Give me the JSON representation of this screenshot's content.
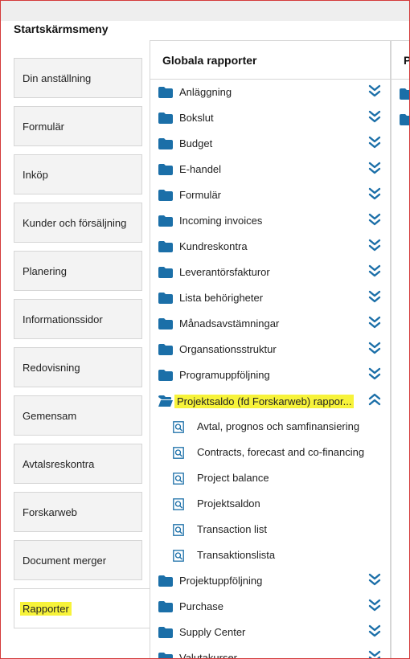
{
  "page_title": "Startskärmsmeny",
  "menu": [
    {
      "label": "Din anställning"
    },
    {
      "label": "Formulär"
    },
    {
      "label": "Inköp"
    },
    {
      "label": "Kunder och försäljning"
    },
    {
      "label": "Planering"
    },
    {
      "label": "Informationssidor"
    },
    {
      "label": "Redovisning"
    },
    {
      "label": "Gemensam"
    },
    {
      "label": "Avtalsreskontra"
    },
    {
      "label": "Forskarweb"
    },
    {
      "label": "Document merger"
    },
    {
      "label": "Rapporter",
      "active": true
    }
  ],
  "panel": {
    "title": "Globala rapporter",
    "folders_before": [
      "Anläggning",
      "Bokslut",
      "Budget",
      "E-handel",
      "Formulär",
      "Incoming invoices",
      "Kundreskontra",
      "Leverantörsfakturor",
      "Lista behörigheter",
      "Månadsavstämningar",
      "Organsationsstruktur",
      "Programuppföljning"
    ],
    "expanded_folder": "Projektsaldo (fd Forskarweb) rappor...",
    "expanded_items": [
      "Avtal, prognos och samfinansiering",
      "Contracts, forecast and co-financing",
      "Project balance",
      "Projektsaldon",
      "Transaction list",
      "Transaktionslista"
    ],
    "folders_after": [
      "Projektuppföljning",
      "Purchase",
      "Supply Center",
      "Valutakurser"
    ]
  },
  "peek_panel": {
    "title_fragment": "P"
  },
  "colors": {
    "folder": "#1b6fa8",
    "chevron": "#1b6fa8",
    "highlight": "#f7f33a",
    "frame": "#d43a3a"
  },
  "icons": {
    "folder": "folder-icon",
    "open_folder": "folder-open-icon",
    "chevron_down": "chevron-double-down-icon",
    "chevron_up": "chevron-double-up-icon",
    "report": "report-search-icon"
  }
}
